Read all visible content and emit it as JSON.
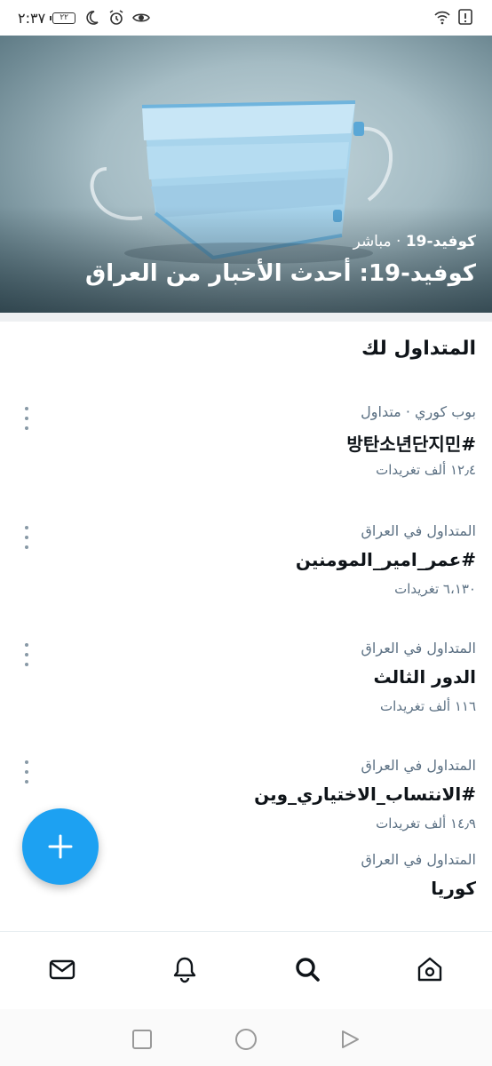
{
  "status_bar": {
    "time": "٢:٣٧",
    "battery": "٢٢",
    "icons": [
      "battery-icon",
      "moon-icon",
      "alarm-icon",
      "eye-icon",
      "wifi-icon",
      "alert-icon"
    ]
  },
  "hero": {
    "category": "كوفيد-19",
    "separator": " · ",
    "live_label": "مباشر",
    "title": "كوفيد-19: أحدث الأخبار من العراق"
  },
  "trends": {
    "section_title": "المتداول لك",
    "items": [
      {
        "context": "بوب كوري · متداول",
        "name": "#방탄소년단지민",
        "count": "١٢٫٤ ألف تغريدات"
      },
      {
        "context": "المتداول في العراق",
        "name": "#عمر_امير_المومنين",
        "count": "٦،١٣٠ تغريدات"
      },
      {
        "context": "المتداول في العراق",
        "name": "الدور الثالث",
        "count": "١١٦ ألف تغريدات"
      },
      {
        "context": "المتداول في العراق",
        "name": "#الانتساب_الاختياري_وين",
        "count": "١٤٫٩ ألف تغريدات"
      },
      {
        "context": "المتداول في العراق",
        "name": "كوريا",
        "count": ""
      }
    ]
  },
  "fab": {
    "icon": "plus-icon"
  },
  "bottom_nav": {
    "items": [
      "mail-icon",
      "bell-icon",
      "search-icon",
      "home-icon"
    ]
  },
  "system_nav": {
    "items": [
      "square-icon",
      "circle-icon",
      "triangle-icon"
    ]
  },
  "colors": {
    "accent": "#1da1f2",
    "secondary_text": "#5b7083",
    "primary_text": "#0f1419"
  }
}
